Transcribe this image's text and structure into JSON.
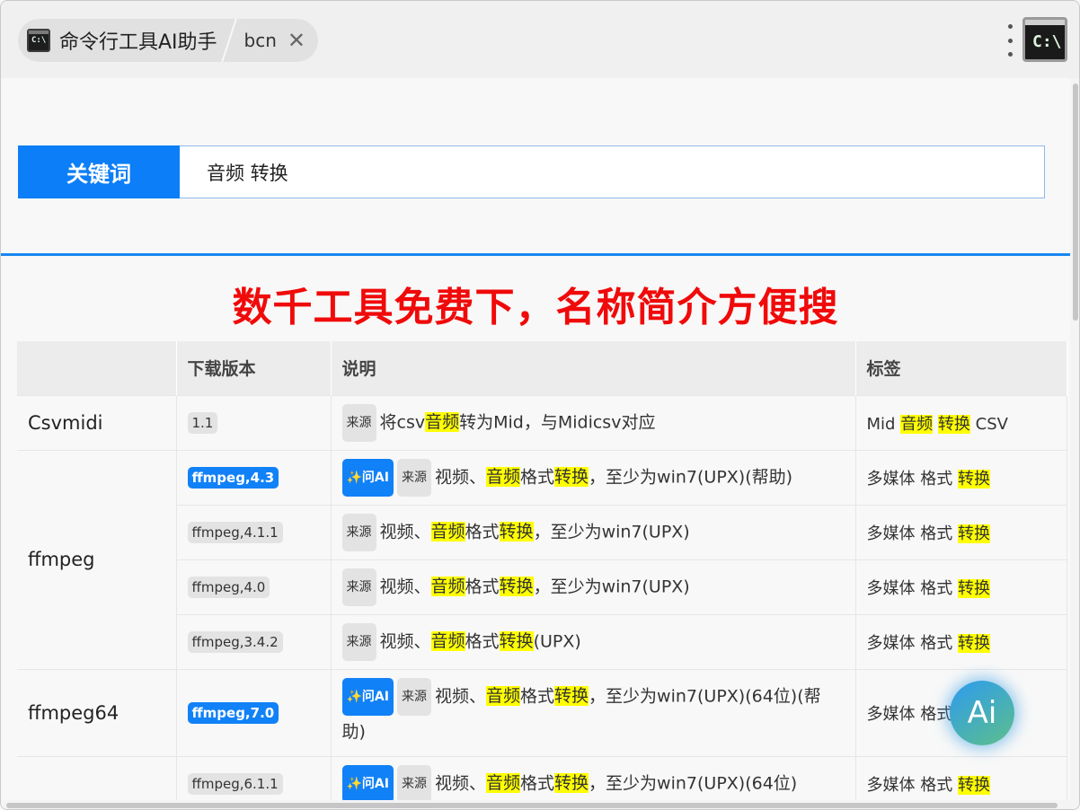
{
  "tab": {
    "title": "命令行工具AI助手",
    "subtitle": "bcn",
    "close_glyph": "✕",
    "icon_text": "C:\\"
  },
  "app_icon_text": "C:\\",
  "search": {
    "label": "关键词",
    "value": "音频 转换"
  },
  "headline": "数千工具免费下，名称简介方便搜",
  "table": {
    "headers": [
      "",
      "下载版本",
      "说明",
      "标签"
    ],
    "source_label": "来源",
    "ai_label": "✨问AI",
    "rows": [
      {
        "name": "Csvmidi",
        "version": "1.1",
        "primary": false,
        "ai": false,
        "desc": [
          [
            "将csv",
            false
          ],
          [
            "音频",
            true
          ],
          [
            "转为Mid，与Midicsv对应",
            false
          ]
        ],
        "tags": [
          [
            "Mid ",
            false
          ],
          [
            "音频",
            true
          ],
          [
            " ",
            false
          ],
          [
            "转换",
            true
          ],
          [
            " CSV",
            false
          ]
        ]
      },
      {
        "name": "ffmpeg",
        "version": "ffmpeg,4.3",
        "primary": true,
        "ai": true,
        "desc": [
          [
            "视频、",
            false
          ],
          [
            "音频",
            true
          ],
          [
            "格式",
            false
          ],
          [
            "转换",
            true
          ],
          [
            "，至少为win7(UPX)(帮助)",
            false
          ]
        ],
        "tags": [
          [
            "多媒体 格式 ",
            false
          ],
          [
            "转换",
            true
          ]
        ]
      },
      {
        "version": "ffmpeg,4.1.1",
        "primary": false,
        "ai": false,
        "desc": [
          [
            "视频、",
            false
          ],
          [
            "音频",
            true
          ],
          [
            "格式",
            false
          ],
          [
            "转换",
            true
          ],
          [
            "，至少为win7(UPX)",
            false
          ]
        ],
        "tags": [
          [
            "多媒体 格式 ",
            false
          ],
          [
            "转换",
            true
          ]
        ]
      },
      {
        "version": "ffmpeg,4.0",
        "primary": false,
        "ai": false,
        "desc": [
          [
            "视频、",
            false
          ],
          [
            "音频",
            true
          ],
          [
            "格式",
            false
          ],
          [
            "转换",
            true
          ],
          [
            "，至少为win7(UPX)",
            false
          ]
        ],
        "tags": [
          [
            "多媒体 格式 ",
            false
          ],
          [
            "转换",
            true
          ]
        ]
      },
      {
        "version": "ffmpeg,3.4.2",
        "primary": false,
        "ai": false,
        "desc": [
          [
            "视频、",
            false
          ],
          [
            "音频",
            true
          ],
          [
            "格式",
            false
          ],
          [
            "转换",
            true
          ],
          [
            "(UPX)",
            false
          ]
        ],
        "tags": [
          [
            "多媒体 格式 ",
            false
          ],
          [
            "转换",
            true
          ]
        ]
      },
      {
        "name": "ffmpeg64",
        "version": "ffmpeg,7.0",
        "primary": true,
        "ai": true,
        "desc": [
          [
            "视频、",
            false
          ],
          [
            "音频",
            true
          ],
          [
            "格式",
            false
          ],
          [
            "转换",
            true
          ],
          [
            "，至少为win7(UPX)(64位)(帮助)",
            false
          ]
        ],
        "tags": [
          [
            "多媒体 格式 ",
            false
          ],
          [
            "转换",
            true
          ]
        ]
      },
      {
        "name": "",
        "version": "ffmpeg,6.1.1",
        "primary": false,
        "ai": true,
        "desc": [
          [
            "视频、",
            false
          ],
          [
            "音频",
            true
          ],
          [
            "格式",
            false
          ],
          [
            "转换",
            true
          ],
          [
            "，至少为win7(UPX)(64位)",
            false
          ]
        ],
        "tags": [
          [
            "多媒体 格式 ",
            false
          ],
          [
            "转换",
            true
          ]
        ]
      }
    ]
  },
  "ai_button": "Ai"
}
